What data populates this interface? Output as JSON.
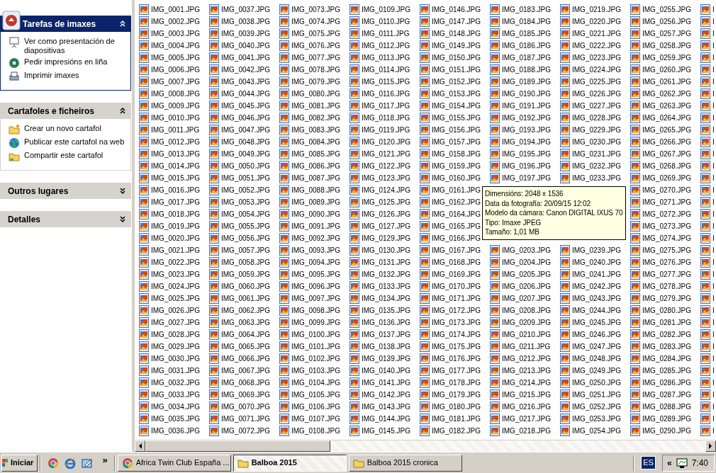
{
  "task_panels": [
    {
      "title": "Tarefas de imaxes",
      "kind": "special",
      "expanded": true,
      "items": [
        {
          "label": "Ver como presentación de diapositivas",
          "kind": "slideshow"
        },
        {
          "label": "Pedir impresións en liña",
          "kind": "online-print"
        },
        {
          "label": "Imprimir imaxes",
          "kind": "printer"
        }
      ]
    },
    {
      "title": "Cartafoles e ficheiros",
      "kind": "normal",
      "expanded": true,
      "items": [
        {
          "label": "Crear un novo cartafol",
          "kind": "new-folder"
        },
        {
          "label": "Publicar este cartafol na web",
          "kind": "globe"
        },
        {
          "label": "Compartir este cartafol",
          "kind": "shared-folder"
        }
      ]
    },
    {
      "title": "Outros lugares",
      "kind": "normal",
      "expanded": false
    },
    {
      "title": "Detalles",
      "kind": "normal",
      "expanded": false
    }
  ],
  "files": {
    "columns": [
      [
        "IMG_0001.JPG",
        "IMG_0002.JPG",
        "IMG_0003.JPG",
        "IMG_0004.JPG",
        "IMG_0005.JPG",
        "IMG_0006.JPG",
        "IMG_0007.JPG",
        "IMG_0008.JPG",
        "IMG_0009.JPG",
        "IMG_0010.JPG",
        "IMG_0011.JPG",
        "IMG_0012.JPG",
        "IMG_0013.JPG",
        "IMG_0014.JPG",
        "IMG_0015.JPG",
        "IMG_0016.JPG",
        "IMG_0017.JPG",
        "IMG_0018.JPG",
        "IMG_0019.JPG",
        "IMG_0020.JPG",
        "IMG_0021.JPG",
        "IMG_0022.JPG",
        "IMG_0023.JPG",
        "IMG_0024.JPG",
        "IMG_0025.JPG",
        "IMG_0026.JPG",
        "IMG_0027.JPG",
        "IMG_0028.JPG",
        "IMG_0029.JPG",
        "IMG_0030.JPG",
        "IMG_0031.JPG",
        "IMG_0032.JPG",
        "IMG_0033.JPG",
        "IMG_0034.JPG",
        "IMG_0035.JPG",
        "IMG_0036.JPG"
      ],
      [
        "IMG_0037.JPG",
        "IMG_0038.JPG",
        "IMG_0039.JPG",
        "IMG_0040.JPG",
        "IMG_0041.JPG",
        "IMG_0042.JPG",
        "IMG_0043.JPG",
        "IMG_0044.JPG",
        "IMG_0045.JPG",
        "IMG_0046.JPG",
        "IMG_0047.JPG",
        "IMG_0048.JPG",
        "IMG_0049.JPG",
        "IMG_0050.JPG",
        "IMG_0051.JPG",
        "IMG_0052.JPG",
        "IMG_0053.JPG",
        "IMG_0054.JPG",
        "IMG_0055.JPG",
        "IMG_0056.JPG",
        "IMG_0057.JPG",
        "IMG_0058.JPG",
        "IMG_0059.JPG",
        "IMG_0060.JPG",
        "IMG_0061.JPG",
        "IMG_0062.JPG",
        "IMG_0063.JPG",
        "IMG_0064.JPG",
        "IMG_0065.JPG",
        "IMG_0066.JPG",
        "IMG_0067.JPG",
        "IMG_0068.JPG",
        "IMG_0069.JPG",
        "IMG_0070.JPG",
        "IMG_0071.JPG",
        "IMG_0072.JPG"
      ],
      [
        "IMG_0073.JPG",
        "IMG_0074.JPG",
        "IMG_0075.JPG",
        "IMG_0076.JPG",
        "IMG_0077.JPG",
        "IMG_0078.JPG",
        "IMG_0079.JPG",
        "IMG_0080.JPG",
        "IMG_0081.JPG",
        "IMG_0082.JPG",
        "IMG_0083.JPG",
        "IMG_0084.JPG",
        "IMG_0085.JPG",
        "IMG_0086.JPG",
        "IMG_0087.JPG",
        "IMG_0088.JPG",
        "IMG_0089.JPG",
        "IMG_0090.JPG",
        "IMG_0091.JPG",
        "IMG_0092.JPG",
        "IMG_0093.JPG",
        "IMG_0094.JPG",
        "IMG_0095.JPG",
        "IMG_0096.JPG",
        "IMG_0097.JPG",
        "IMG_0098.JPG",
        "IMG_0099.JPG",
        "IMG_0100.JPG",
        "IMG_0101.JPG",
        "IMG_0102.JPG",
        "IMG_0103.JPG",
        "IMG_0104.JPG",
        "IMG_0105.JPG",
        "IMG_0106.JPG",
        "IMG_0107.JPG",
        "IMG_0108.JPG"
      ],
      [
        "IMG_0109.JPG",
        "IMG_0110.JPG",
        "IMG_0111.JPG",
        "IMG_0112.JPG",
        "IMG_0113.JPG",
        "IMG_0114.JPG",
        "IMG_0115.JPG",
        "IMG_0116.JPG",
        "IMG_0117.JPG",
        "IMG_0118.JPG",
        "IMG_0119.JPG",
        "IMG_0120.JPG",
        "IMG_0121.JPG",
        "IMG_0122.JPG",
        "IMG_0123.JPG",
        "IMG_0124.JPG",
        "IMG_0125.JPG",
        "IMG_0126.JPG",
        "IMG_0127.JPG",
        "IMG_0129.JPG",
        "IMG_0130.JPG",
        "IMG_0131.JPG",
        "IMG_0132.JPG",
        "IMG_0133.JPG",
        "IMG_0134.JPG",
        "IMG_0135.JPG",
        "IMG_0136.JPG",
        "IMG_0137.JPG",
        "IMG_0138.JPG",
        "IMG_0139.JPG",
        "IMG_0140.JPG",
        "IMG_0141.JPG",
        "IMG_0142.JPG",
        "IMG_0143.JPG",
        "IMG_0144.JPG",
        "IMG_0145.JPG"
      ],
      [
        "IMG_0146.JPG",
        "IMG_0147.JPG",
        "IMG_0148.JPG",
        "IMG_0149.JPG",
        "IMG_0150.JPG",
        "IMG_0151.JPG",
        "IMG_0152.JPG",
        "IMG_0153.JPG",
        "IMG_0154.JPG",
        "IMG_0155.JPG",
        "IMG_0156.JPG",
        "IMG_0157.JPG",
        "IMG_0158.JPG",
        "IMG_0159.JPG",
        "IMG_0160.JPG",
        "IMG_0161.JPG",
        "IMG_0162.JPG",
        "IMG_0164.JPG",
        "IMG_0165.JPG",
        "IMG_0166.JPG",
        "IMG_0167.JPG",
        "IMG_0168.JPG",
        "IMG_0169.JPG",
        "IMG_0170.JPG",
        "IMG_0171.JPG",
        "IMG_0172.JPG",
        "IMG_0173.JPG",
        "IMG_0174.JPG",
        "IMG_0175.JPG",
        "IMG_0176.JPG",
        "IMG_0177.JPG",
        "IMG_0178.JPG",
        "IMG_0179.JPG",
        "IMG_0180.JPG",
        "IMG_0181.JPG",
        "IMG_0182.JPG"
      ],
      [
        "IMG_0183.JPG",
        "IMG_0184.JPG",
        "IMG_0185.JPG",
        "IMG_0186.JPG",
        "IMG_0187.JPG",
        "IMG_0188.JPG",
        "IMG_0189.JPG",
        "IMG_0190.JPG",
        "IMG_0191.JPG",
        "IMG_0192.JPG",
        "IMG_0193.JPG",
        "IMG_0194.JPG",
        "IMG_0195.JPG",
        "IMG_0196.JPG",
        "IMG_0197.JPG",
        null,
        null,
        null,
        null,
        null,
        "IMG_0203.JPG",
        "IMG_0204.JPG",
        "IMG_0205.JPG",
        "IMG_0206.JPG",
        "IMG_0207.JPG",
        "IMG_0208.JPG",
        "IMG_0209.JPG",
        "IMG_0210.JPG",
        "IMG_0211.JPG",
        "IMG_0212.JPG",
        "IMG_0213.JPG",
        "IMG_0214.JPG",
        "IMG_0215.JPG",
        "IMG_0216.JPG",
        "IMG_0217.JPG",
        "IMG_0218.JPG"
      ],
      [
        "IMG_0219.JPG",
        "IMG_0220.JPG",
        "IMG_0221.JPG",
        "IMG_0222.JPG",
        "IMG_0223.JPG",
        "IMG_0224.JPG",
        "IMG_0225.JPG",
        "IMG_0226.JPG",
        "IMG_0227.JPG",
        "IMG_0228.JPG",
        "IMG_0229.JPG",
        "IMG_0230.JPG",
        "IMG_0231.JPG",
        "IMG_0232.JPG",
        "IMG_0233.JPG",
        null,
        null,
        null,
        null,
        null,
        "IMG_0239.JPG",
        "IMG_0240.JPG",
        "IMG_0241.JPG",
        "IMG_0242.JPG",
        "IMG_0243.JPG",
        "IMG_0244.JPG",
        "IMG_0245.JPG",
        "IMG_0246.JPG",
        "IMG_0247.JPG",
        "IMG_0248.JPG",
        "IMG_0249.JPG",
        "IMG_0250.JPG",
        "IMG_0251.JPG",
        "IMG_0252.JPG",
        "IMG_0253.JPG",
        "IMG_0254.JPG"
      ],
      [
        "IMG_0255.JPG",
        "IMG_0256.JPG",
        "IMG_0257.JPG",
        "IMG_0258.JPG",
        "IMG_0259.JPG",
        "IMG_0260.JPG",
        "IMG_0261.JPG",
        "IMG_0262.JPG",
        "IMG_0263.JPG",
        "IMG_0264.JPG",
        "IMG_0265.JPG",
        "IMG_0266.JPG",
        "IMG_0267.JPG",
        "IMG_0268.JPG",
        "IMG_0269.JPG",
        "IMG_0270.JPG",
        "IMG_0271.JPG",
        "IMG_0272.JPG",
        "IMG_0273.JPG",
        "IMG_0274.JPG",
        "IMG_0275.JPG",
        "IMG_0276.JPG",
        "IMG_0277.JPG",
        "IMG_0278.JPG",
        "IMG_0279.JPG",
        "IMG_0280.JPG",
        "IMG_0281.JPG",
        "IMG_0282.JPG",
        "IMG_0283.JPG",
        "IMG_0284.JPG",
        "IMG_0285.JPG",
        "IMG_0286.JPG",
        "IMG_0287.JPG",
        "IMG_0288.JPG",
        "IMG_0289.JPG",
        "IMG_0290.JPG"
      ],
      [
        "I",
        "I",
        "I",
        "I",
        "I",
        "I",
        "I",
        "I",
        "I",
        "I",
        "I",
        "I",
        "I",
        "I",
        "I",
        "I",
        "I",
        "I",
        "I",
        "I",
        "I",
        "I",
        "I",
        "I",
        "I",
        "I",
        "I",
        "I",
        "I",
        "I",
        "I",
        "I",
        "I",
        "I",
        "I",
        "I"
      ]
    ]
  },
  "tooltip": {
    "lines": [
      "Dimensións: 2048 x 1536",
      "Data da fotografía: 20/09/15 12:02",
      "Modelo da cámara: Canon DIGITAL IXUS 70",
      "Tipo: Imaxe JPEG",
      "Tamaño: 1,01 MB"
    ]
  },
  "taskbar": {
    "start": "Iniciar",
    "more": "»",
    "tasks": [
      {
        "label": "Africa Twin Club España ...",
        "kind": "browser",
        "selected": false
      },
      {
        "label": "Balboa 2015",
        "kind": "folder",
        "selected": true
      },
      {
        "label": "Balboa 2015 cronica",
        "kind": "folder",
        "selected": false
      }
    ],
    "language": "ES",
    "tray_more": "«",
    "clock": "7:40"
  }
}
